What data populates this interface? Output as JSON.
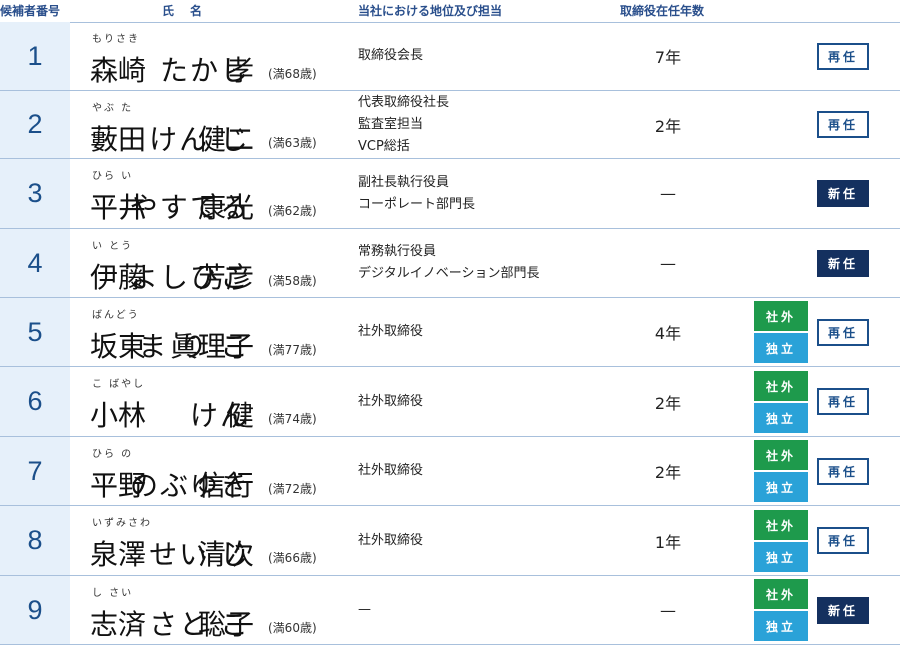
{
  "header": {
    "number": "候補者番号",
    "name": "氏　名",
    "position": "当社における地位及び担当",
    "years": "取締役在任年数"
  },
  "candidates": [
    {
      "number": "1",
      "surname": "森崎",
      "given": "孝",
      "surname_furi": "もりさき",
      "given_furi": "たかし",
      "age": "(満68歳)",
      "position": [
        "取締役会長"
      ],
      "years": "7年",
      "outside": "",
      "independent": "",
      "status": "再任",
      "status_type": "re"
    },
    {
      "number": "2",
      "surname": "藪田",
      "given": "健二",
      "surname_furi": "やぶ た",
      "given_furi": "けん じ",
      "age": "(満63歳)",
      "position": [
        "代表取締役社長",
        "監査室担当",
        "VCP総括"
      ],
      "years": "2年",
      "outside": "",
      "independent": "",
      "status": "再任",
      "status_type": "re"
    },
    {
      "number": "3",
      "surname": "平井",
      "given": "康光",
      "surname_furi": "ひら い",
      "given_furi": "やすてる",
      "age": "(満62歳)",
      "position": [
        "副社長執行役員",
        "コーポレート部門長"
      ],
      "years": "—",
      "outside": "",
      "independent": "",
      "status": "新任",
      "status_type": "new"
    },
    {
      "number": "4",
      "surname": "伊藤",
      "given": "芳彦",
      "surname_furi": "い とう",
      "given_furi": "よしひこ",
      "age": "(満58歳)",
      "position": [
        "常務執行役員",
        "デジタルイノベーション部門長"
      ],
      "years": "—",
      "outside": "",
      "independent": "",
      "status": "新任",
      "status_type": "new"
    },
    {
      "number": "5",
      "surname": "坂東",
      "given": "眞理子",
      "surname_furi": "ばんどう",
      "given_furi": "ま り こ",
      "age": "(満77歳)",
      "position": [
        "社外取締役"
      ],
      "years": "4年",
      "outside": "社外",
      "independent": "独立",
      "status": "再任",
      "status_type": "re"
    },
    {
      "number": "6",
      "surname": "小林",
      "given": "健",
      "surname_furi": "こ ばやし",
      "given_furi": "けん",
      "age": "(満74歳)",
      "position": [
        "社外取締役"
      ],
      "years": "2年",
      "outside": "社外",
      "independent": "独立",
      "status": "再任",
      "status_type": "re"
    },
    {
      "number": "7",
      "surname": "平野",
      "given": "信行",
      "surname_furi": "ひら の",
      "given_furi": "のぶゆき",
      "age": "(満72歳)",
      "position": [
        "社外取締役"
      ],
      "years": "2年",
      "outside": "社外",
      "independent": "独立",
      "status": "再任",
      "status_type": "re"
    },
    {
      "number": "8",
      "surname": "泉澤",
      "given": "清次",
      "surname_furi": "いずみさわ",
      "given_furi": "せい じ",
      "age": "(満66歳)",
      "position": [
        "社外取締役"
      ],
      "years": "1年",
      "outside": "社外",
      "independent": "独立",
      "status": "再任",
      "status_type": "re"
    },
    {
      "number": "9",
      "surname": "志済",
      "given": "聡子",
      "surname_furi": "し さい",
      "given_furi": "さと こ",
      "age": "(満60歳)",
      "position": [
        "—"
      ],
      "years": "—",
      "outside": "社外",
      "independent": "独立",
      "status": "新任",
      "status_type": "new"
    }
  ]
}
